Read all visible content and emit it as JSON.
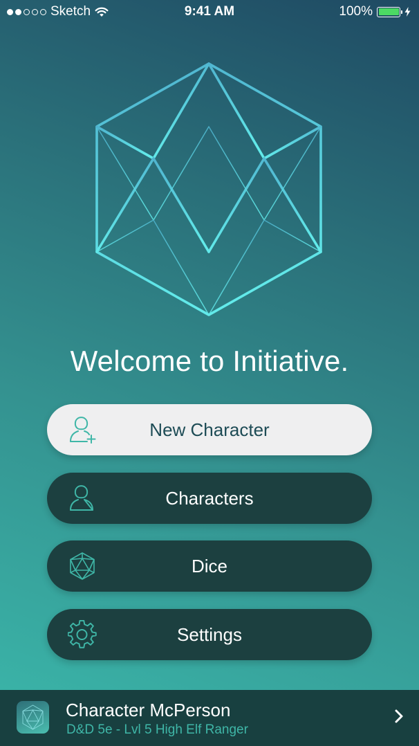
{
  "status_bar": {
    "carrier": "Sketch",
    "time": "9:41 AM",
    "battery_percent": "100%",
    "signal_bars_filled": 2,
    "signal_bars_total": 5
  },
  "app_icon": "d20-icosahedron-logo-icon",
  "welcome_text": "Welcome to Initiative.",
  "menu": [
    {
      "label": "New Character",
      "icon": "add-person-icon",
      "style": "light"
    },
    {
      "label": "Characters",
      "icon": "person-icon",
      "style": "dark"
    },
    {
      "label": "Dice",
      "icon": "d20-icon",
      "style": "dark"
    },
    {
      "label": "Settings",
      "icon": "gear-icon",
      "style": "dark"
    }
  ],
  "current_character": {
    "name": "Character McPerson",
    "subtitle": "D&D 5e - Lvl 5 High Elf Ranger"
  },
  "colors": {
    "accent": "#3fb6a7",
    "logo_stroke": "#5ad8e0",
    "button_dark": "#1c4040",
    "button_light": "#efeff0",
    "battery": "#4cd964"
  }
}
